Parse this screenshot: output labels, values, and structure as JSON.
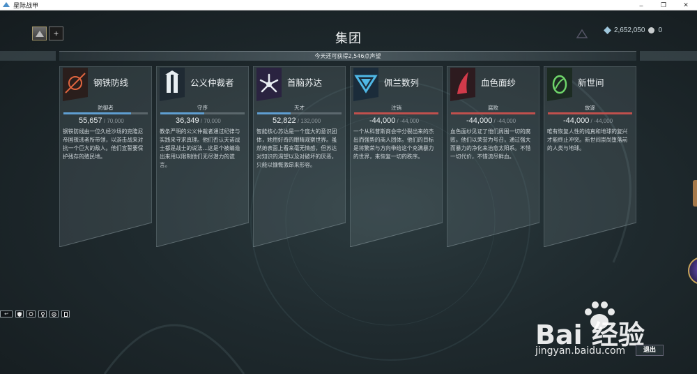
{
  "window": {
    "title": "星际战甲",
    "minimize": "–",
    "maximize": "❐",
    "close": "✕"
  },
  "header": {
    "title": "集团",
    "add_label": "+",
    "platinum": "2,652,050",
    "other_currency": "0"
  },
  "standing_notice": "今天还可获得2,546点声望",
  "cards": [
    {
      "name": "钢铁防线",
      "rank": "防御者",
      "standing": "55,657",
      "max": " / 70,000",
      "progress": 0.795,
      "bar_color": "#5f9ed1",
      "desc": "钢铁防线由一位久经沙场的克隆尼帝国叛逃者所带领，以游击战来对抗一个巨大的敌人。他们宣誓要保护残存的殖民地。",
      "emblem": "steel-meridian-icon",
      "emblem_bg": "#2a1e1c"
    },
    {
      "name": "公义仲裁者",
      "rank": "守序",
      "standing": "36,349",
      "max": " / 70,000",
      "progress": 0.519,
      "bar_color": "#5f9ed1",
      "desc": "教条严明的公义仲裁者通过纪律与实践来寻求真理。他们否认天诺战士都是战士的说法…这是个被编造出来用以限制他们无尽潜力的谎言。",
      "emblem": "arbiters-of-hexis-icon",
      "emblem_bg": "#1f2a33"
    },
    {
      "name": "首脑苏达",
      "rank": "天才",
      "standing": "52,822",
      "max": " / 132,000",
      "progress": 0.4,
      "bar_color": "#5f9ed1",
      "desc": "智能核心苏达是一个庞大的意识团体，她用好奇的眼睛观察世界。虽然她表面上看来毫无情感，但苏达对知识的渴望以及对破坏的厌恶，只能以慷慨激昂来形容。",
      "emblem": "cephalon-suda-icon",
      "emblem_bg": "#2a2340"
    },
    {
      "name": "佩兰数列",
      "rank": "注销",
      "standing": "-44,000",
      "max": " / -44,000",
      "progress": 1,
      "bar_color": "#c0504d",
      "desc": "一个从科普斯商会中分裂出来的杰出而强势的商人团体。他们的目标是将繁荣与方向带给这个充满暴力的世界，来恢复一切的秩序。",
      "emblem": "perrin-sequence-icon",
      "emblem_bg": "#1b2c3a"
    },
    {
      "name": "血色面纱",
      "rank": "腐败",
      "standing": "-44,000",
      "max": " / -44,000",
      "progress": 1,
      "bar_color": "#c0504d",
      "desc": "血色面纱见证了他们周围一切的腐败。他们以荣誉为号召，通过强大而暴力的净化来治愈太阳系。不惜一切代价，不惜流尽鲜血。",
      "emblem": "red-veil-icon",
      "emblem_bg": "#2d1b1f"
    },
    {
      "name": "新世间",
      "rank": "放逐",
      "standing": "-44,000",
      "max": " / -44,000",
      "progress": 1,
      "bar_color": "#c0504d",
      "desc": "唯有恢复人性的纯真和地球的复兴才能终止冲突。新世间崇尚堕落前的人类与地球。",
      "emblem": "new-loka-icon",
      "emblem_bg": "#1c2b22"
    }
  ],
  "toolbar": {
    "back_key": "↩"
  },
  "back_button": "退出",
  "watermark": {
    "brand": "Bai 经验",
    "url": "jingyan.baidu.com"
  }
}
